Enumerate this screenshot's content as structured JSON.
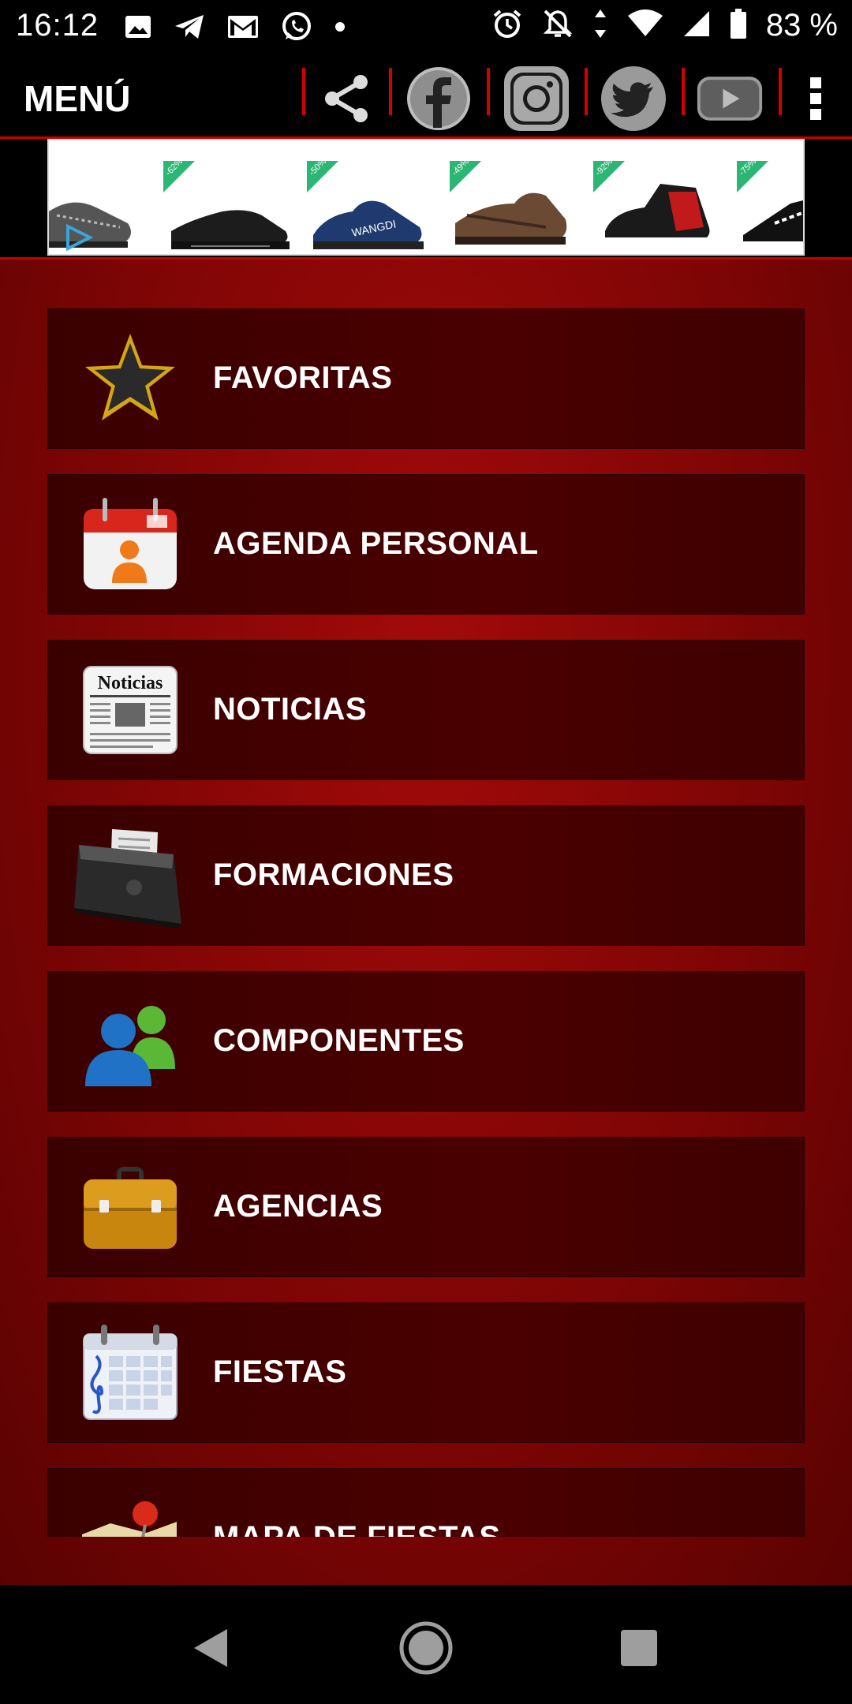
{
  "status_bar": {
    "time": "16:12",
    "battery": "83 %",
    "left_icons": [
      "image-icon",
      "telegram-icon",
      "gmail-icon",
      "whatsapp-icon",
      "dot-icon"
    ],
    "right_icons": [
      "alarm-icon",
      "notifications-off-icon",
      "data-arrows-icon",
      "wifi-icon",
      "signal-icon",
      "battery-icon"
    ]
  },
  "header": {
    "title": "MENÚ",
    "icons": [
      "share-icon",
      "facebook-icon",
      "instagram-icon",
      "twitter-icon",
      "youtube-icon",
      "more-vert-icon"
    ]
  },
  "ad": {
    "badges": [
      "-62%",
      "-50%",
      "-49%",
      "-92%",
      "-75%"
    ],
    "shoe_text": "WANGDI"
  },
  "menu": {
    "items": [
      {
        "label": "FAVORITAS",
        "icon": "star-icon"
      },
      {
        "label": "AGENDA PERSONAL",
        "icon": "calendar-person-icon"
      },
      {
        "label": "NOTICIAS",
        "icon": "newspaper-icon",
        "icon_text": "Noticias"
      },
      {
        "label": "FORMACIONES",
        "icon": "music-folder-icon"
      },
      {
        "label": "COMPONENTES",
        "icon": "users-icon"
      },
      {
        "label": "AGENCIAS",
        "icon": "briefcase-icon"
      },
      {
        "label": "FIESTAS",
        "icon": "music-calendar-icon"
      },
      {
        "label": "MAPA DE FIESTAS",
        "icon": "map-pin-icon"
      }
    ]
  },
  "colors": {
    "accent_red": "#c80000",
    "background_red": "#7e0505",
    "item_bg": "#420000"
  },
  "navbar": {
    "icons": [
      "back-icon",
      "home-icon",
      "recents-icon"
    ]
  }
}
